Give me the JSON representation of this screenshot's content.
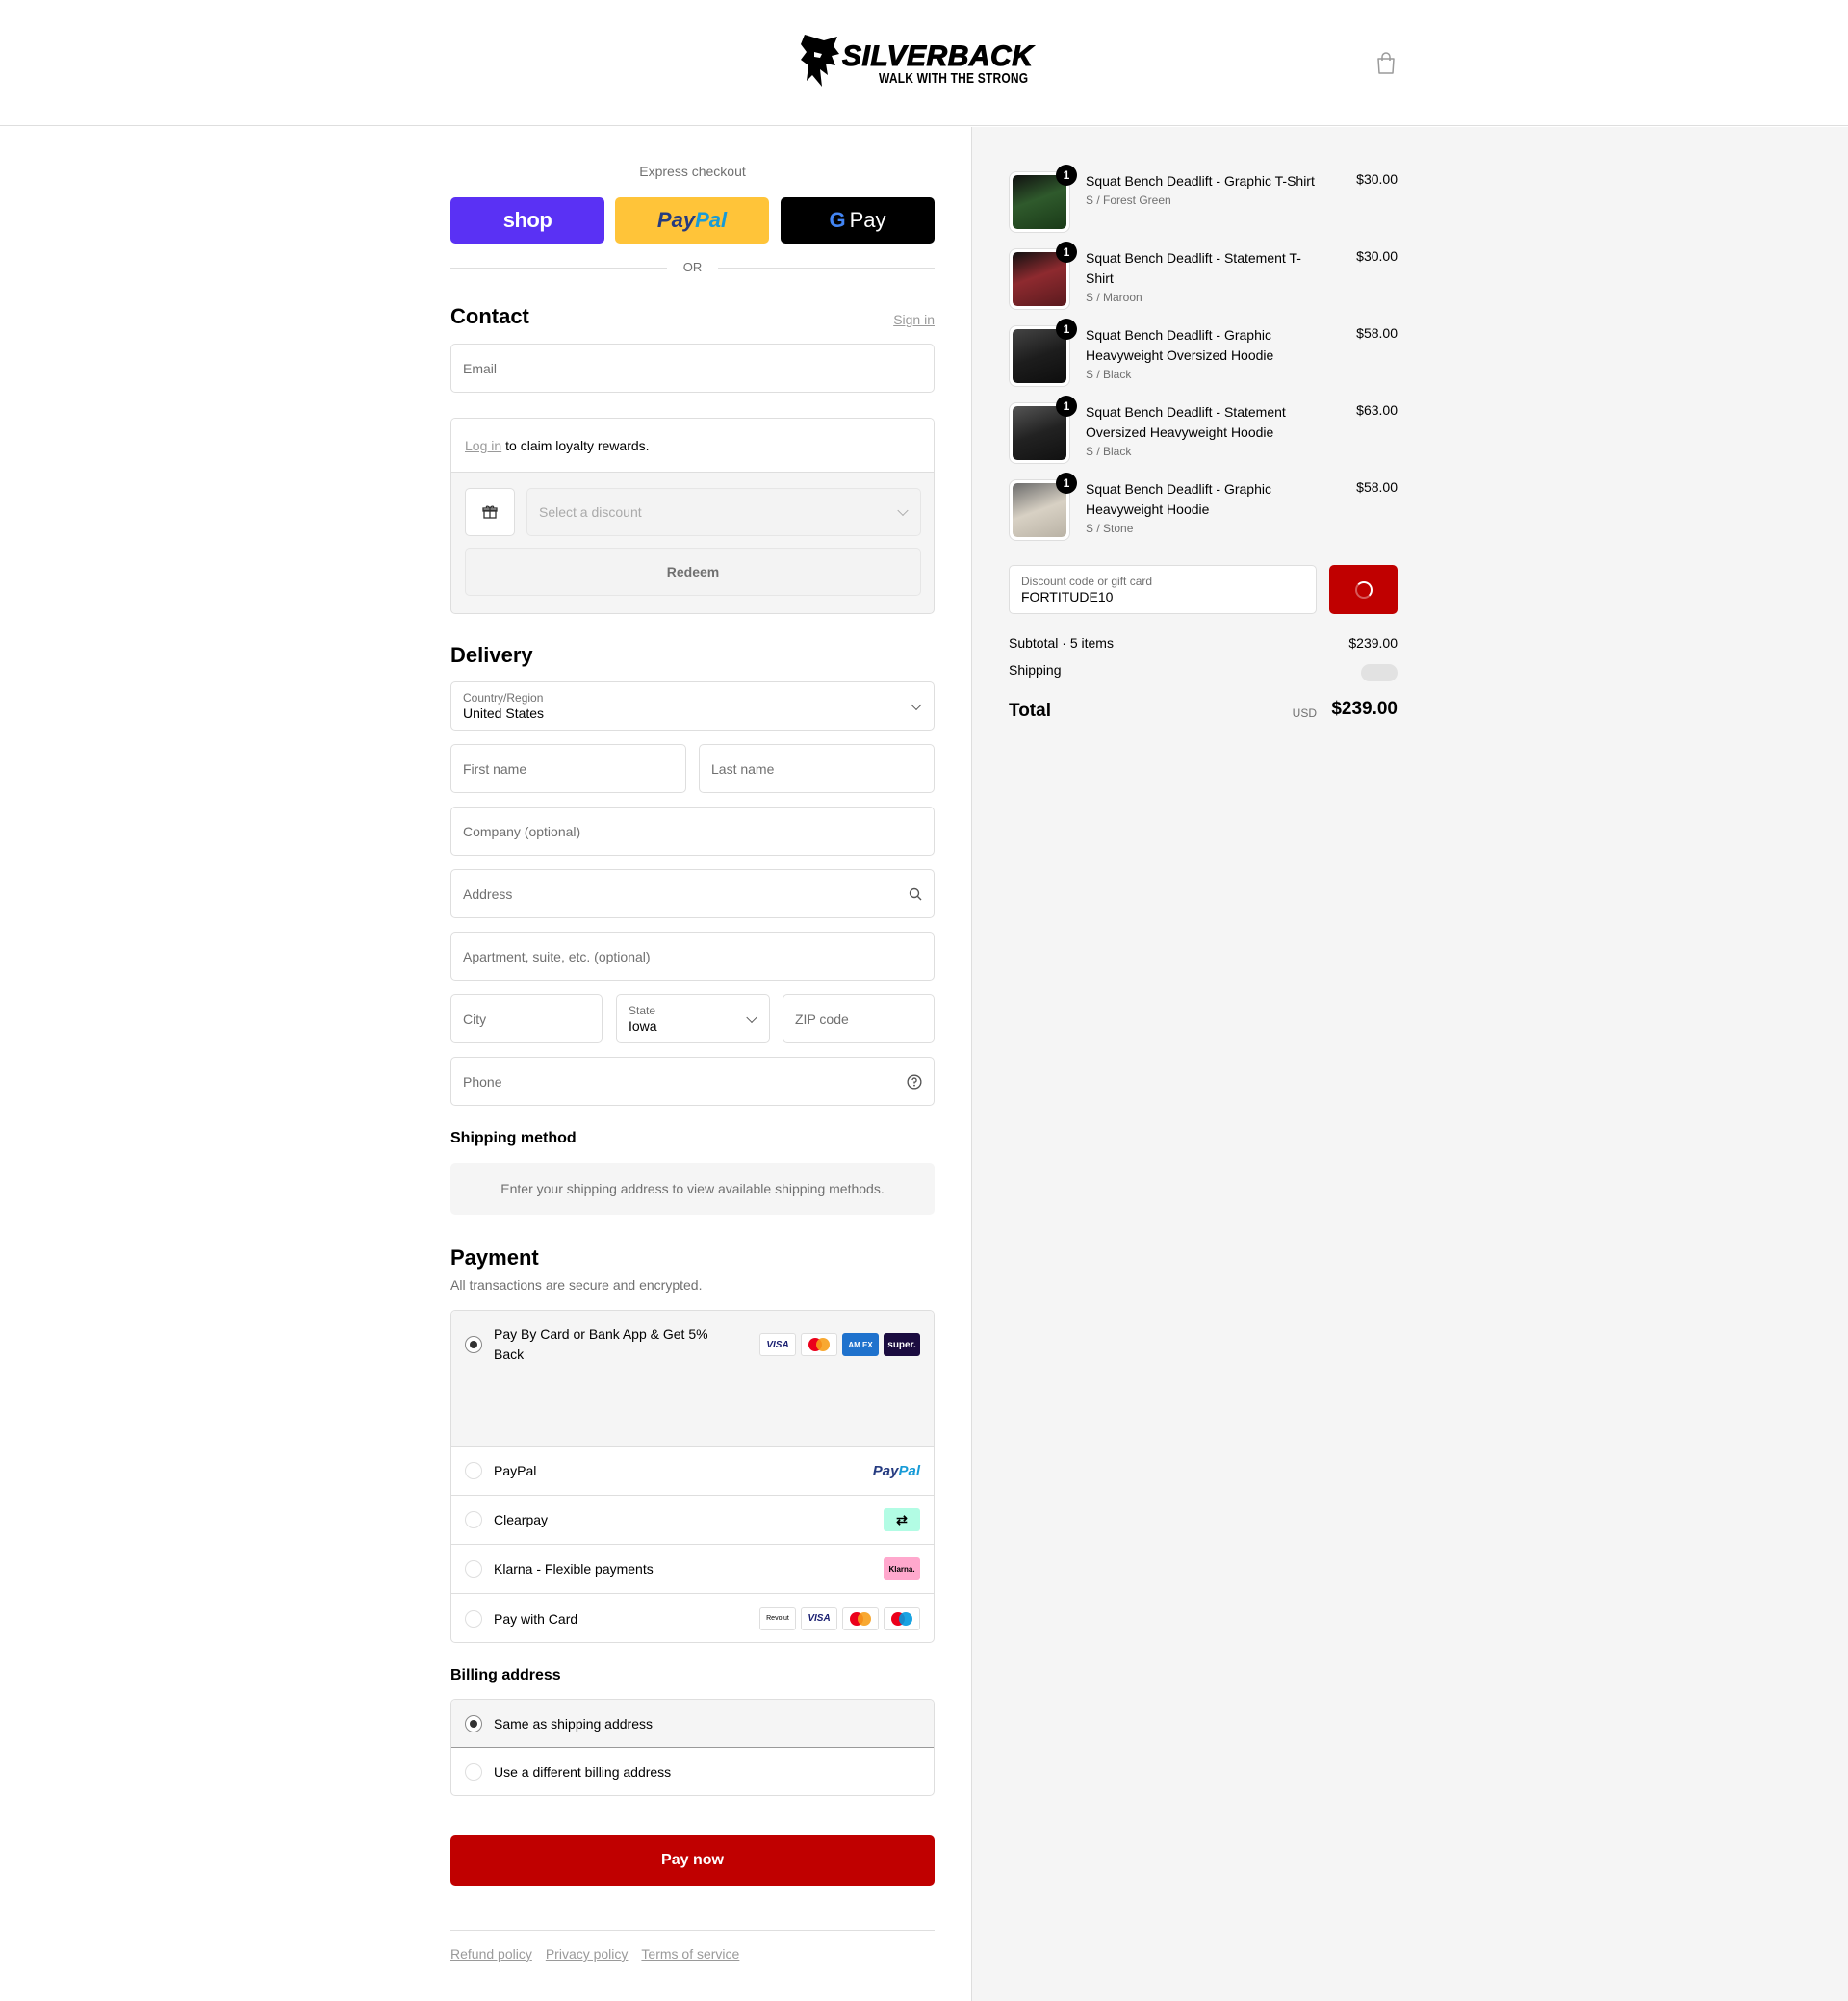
{
  "header": {
    "logo_title": "SILVERBACK",
    "logo_tagline": "WALK WITH THE STRONG",
    "cart_icon": "shopping-bag-icon"
  },
  "express": {
    "label": "Express checkout",
    "shop_label": "shop",
    "paypal_label_a": "Pay",
    "paypal_label_b": "Pal",
    "gpay_g": "G",
    "gpay_label": "Pay",
    "or_label": "OR"
  },
  "contact": {
    "title": "Contact",
    "signin_label": "Sign in",
    "email_placeholder": "Email"
  },
  "loyalty": {
    "login_link": "Log in",
    "text": "to claim loyalty rewards.",
    "gift_icon": "gift-icon",
    "discount_placeholder": "Select a discount",
    "redeem_label": "Redeem"
  },
  "delivery": {
    "title": "Delivery",
    "country_label": "Country/Region",
    "country_value": "United States",
    "first_name": "First name",
    "last_name": "Last name",
    "company": "Company (optional)",
    "address": "Address",
    "apartment": "Apartment, suite, etc. (optional)",
    "city": "City",
    "state_label": "State",
    "state_value": "Iowa",
    "zip": "ZIP code",
    "phone": "Phone"
  },
  "shipping_method": {
    "title": "Shipping method",
    "note": "Enter your shipping address to view available shipping methods."
  },
  "payment": {
    "title": "Payment",
    "subtitle": "All transactions are secure and encrypted.",
    "options": [
      {
        "label_1": "Pay By Card or Bank App & Get 5%",
        "label_2": "Back",
        "selected": true
      },
      {
        "label": "PayPal",
        "logo_a": "Pay",
        "logo_b": "Pal"
      },
      {
        "label": "Clearpay",
        "logo": "⇄"
      },
      {
        "label": "Klarna - Flexible payments",
        "logo": "Klarna."
      },
      {
        "label": "Pay with Card"
      }
    ],
    "card_badges": {
      "visa": "VISA",
      "amex": "AM EX",
      "super": "super.",
      "revolut": "Revolut"
    }
  },
  "billing": {
    "title": "Billing address",
    "same": "Same as shipping address",
    "different": "Use a different billing address"
  },
  "pay_now_label": "Pay now",
  "footer": {
    "refund": "Refund policy",
    "privacy": "Privacy policy",
    "terms": "Terms of service"
  },
  "summary": {
    "items": [
      {
        "qty": "1",
        "name": "Squat Bench Deadlift - Graphic T-Shirt",
        "variant": "S / Forest Green",
        "price": "$30.00",
        "color": "#2f5a2c"
      },
      {
        "qty": "1",
        "name": "Squat Bench Deadlift - Statement T-Shirt",
        "variant": "S / Maroon",
        "price": "$30.00",
        "color": "#8e2a2f"
      },
      {
        "qty": "1",
        "name": "Squat Bench Deadlift - Graphic Heavyweight Oversized Hoodie",
        "variant": "S / Black",
        "price": "$58.00",
        "color": "#1d1d1d"
      },
      {
        "qty": "1",
        "name": "Squat Bench Deadlift - Statement Oversized Heavyweight Hoodie",
        "variant": "S / Black",
        "price": "$63.00",
        "color": "#222222"
      },
      {
        "qty": "1",
        "name": "Squat Bench Deadlift - Graphic Heavyweight Hoodie",
        "variant": "S / Stone",
        "price": "$58.00",
        "color": "#d8d1c4"
      }
    ],
    "discount_label": "Discount code or gift card",
    "discount_value": "FORTITUDE10",
    "subtotal_label": "Subtotal · 5 items",
    "subtotal_value": "$239.00",
    "shipping_label": "Shipping",
    "total_label": "Total",
    "currency": "USD",
    "total_value": "$239.00"
  },
  "colors": {
    "brand_red": "#c00000",
    "shop_purple": "#5a31f4",
    "paypal_yellow": "#ffc439"
  }
}
